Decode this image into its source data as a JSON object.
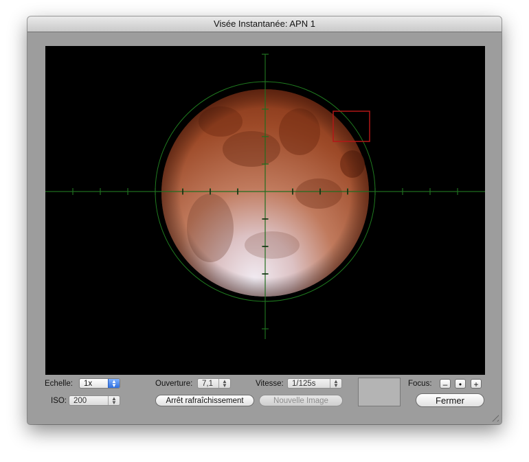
{
  "window": {
    "title": "Visée Instantanée: APN 1"
  },
  "viewer": {
    "crosshair_color": "#1f7a1f",
    "target_box_color": "#b31717",
    "moon_colors": {
      "rim": "#e9e1e6",
      "mid": "#c67a5a",
      "deep": "#8c3517"
    }
  },
  "controls": {
    "echelle": {
      "label": "Echelle:",
      "value": "1x"
    },
    "iso": {
      "label": "ISO:",
      "value": "200"
    },
    "ouverture": {
      "label": "Ouverture:",
      "value": "7,1"
    },
    "vitesse": {
      "label": "Vitesse:",
      "value": "1/125s"
    },
    "focus": {
      "label": "Focus:",
      "minus": "–",
      "dot": "•",
      "plus": "+"
    },
    "buttons": {
      "stop_refresh": "Arrêt rafraîchissement",
      "new_image": "Nouvelle Image",
      "close": "Fermer"
    }
  }
}
